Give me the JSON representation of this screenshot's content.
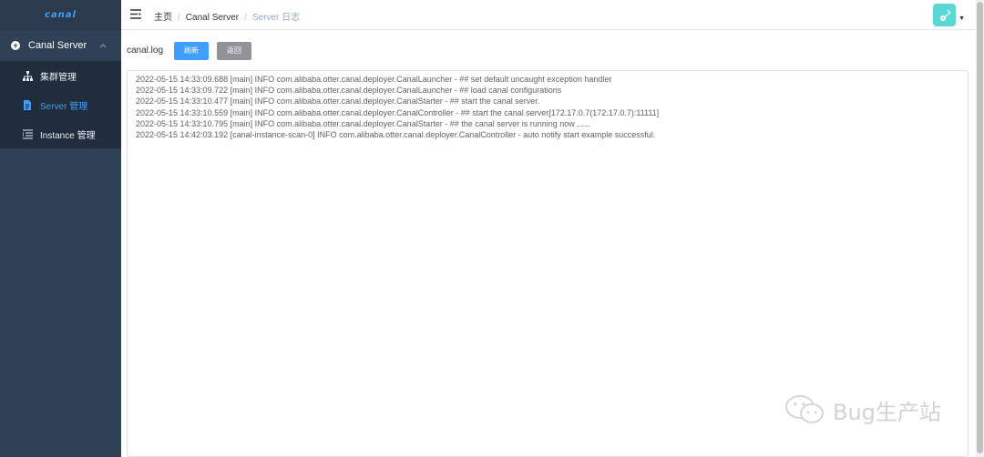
{
  "sidebar": {
    "logo": "canal",
    "group": {
      "label": "Canal Server",
      "icon": "plus-circle-icon"
    },
    "items": [
      {
        "label": "集群管理",
        "icon": "cluster-icon"
      },
      {
        "label": "Server 管理",
        "icon": "document-icon",
        "active": true
      },
      {
        "label": "Instance 管理",
        "icon": "list-icon"
      }
    ]
  },
  "header": {
    "breadcrumb": [
      "主页",
      "Canal Server",
      "Server 日志"
    ],
    "avatar_color": "#5ad8d6"
  },
  "toolbar": {
    "file_label": "canal.log",
    "refresh_label": "刷新",
    "back_label": "返回"
  },
  "log": {
    "lines": [
      "2022-05-15 14:33:09.688 [main] INFO  com.alibaba.otter.canal.deployer.CanalLauncher - ## set default uncaught exception handler",
      "2022-05-15 14:33:09.722 [main] INFO  com.alibaba.otter.canal.deployer.CanalLauncher - ## load canal configurations",
      "2022-05-15 14:33:10.477 [main] INFO  com.alibaba.otter.canal.deployer.CanalStarter - ## start the canal server.",
      "2022-05-15 14:33:10.559 [main] INFO  com.alibaba.otter.canal.deployer.CanalController - ## start the canal server[172.17.0.7(172.17.0.7):11111]",
      "2022-05-15 14:33:10.795 [main] INFO  com.alibaba.otter.canal.deployer.CanalStarter - ## the canal server is running now ......",
      "2022-05-15 14:42:03.192 [canal-instance-scan-0] INFO  com.alibaba.otter.canal.deployer.CanalController - auto notify start example successful."
    ]
  },
  "watermark": {
    "text": "Bug生产站"
  },
  "colors": {
    "sidebar_bg": "#304156",
    "accent": "#409eff",
    "info": "#909399"
  }
}
